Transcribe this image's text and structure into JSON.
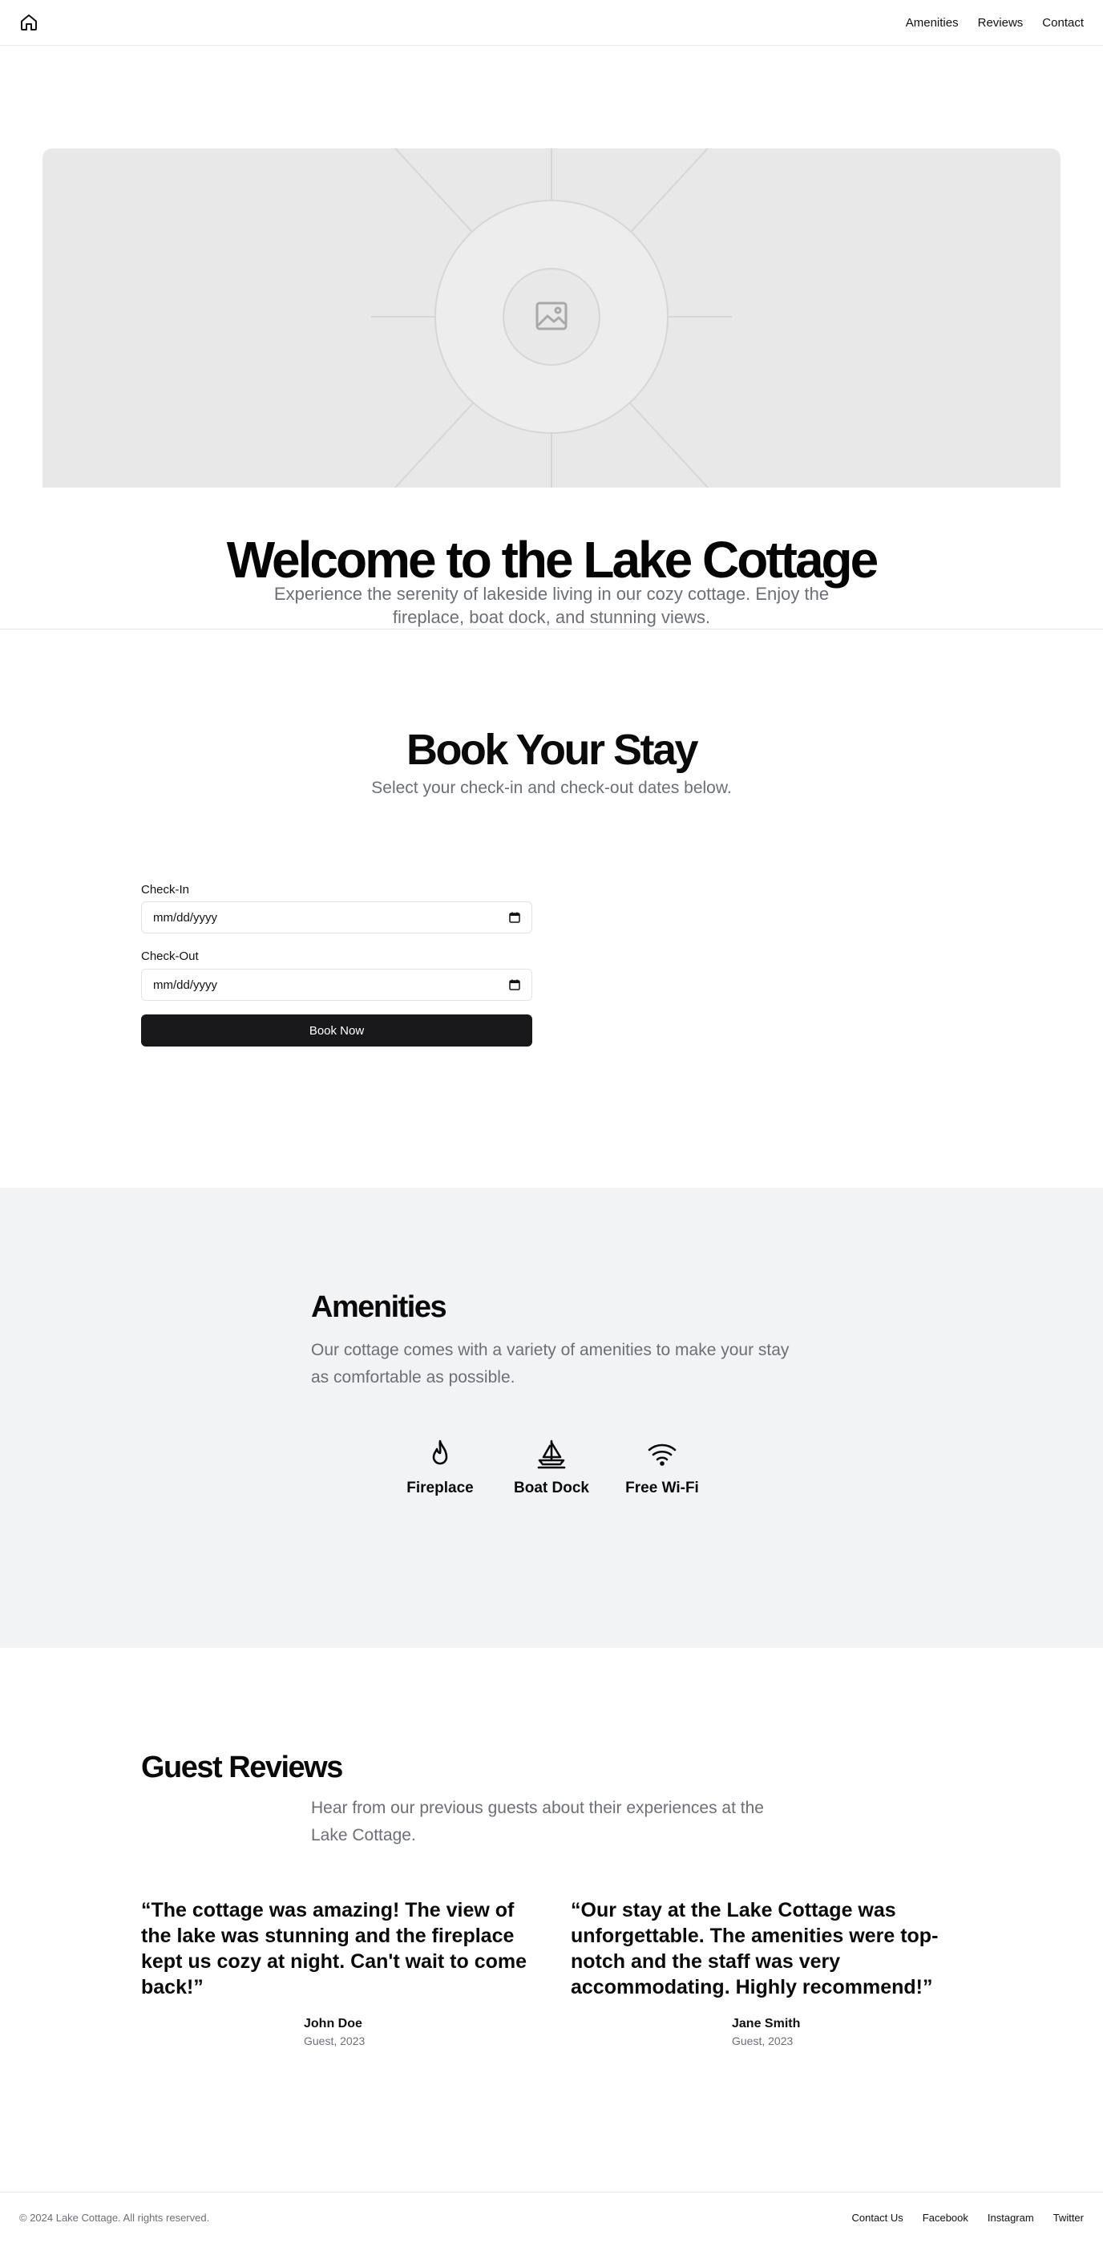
{
  "header": {
    "nav": [
      "Amenities",
      "Reviews",
      "Contact"
    ]
  },
  "hero": {
    "title": "Welcome to the Lake Cottage",
    "subtitle": "Experience the serenity of lakeside living in our cozy cottage. Enjoy the fireplace, boat dock, and stunning views."
  },
  "booking": {
    "title": "Book Your Stay",
    "subtitle": "Select your check-in and check-out dates below.",
    "checkin_label": "Check-In",
    "checkin_value": "mm/dd/yyyy",
    "checkout_label": "Check-Out",
    "checkout_value": "mm/dd/yyyy",
    "button_label": "Book Now"
  },
  "amenities": {
    "title": "Amenities",
    "subtitle": "Our cottage comes with a variety of amenities to make your stay as comfortable as possible.",
    "items": [
      {
        "label": "Fireplace",
        "icon": "flame-icon"
      },
      {
        "label": "Boat Dock",
        "icon": "sailboat-icon"
      },
      {
        "label": "Free Wi-Fi",
        "icon": "wifi-icon"
      }
    ]
  },
  "reviews": {
    "title": "Guest Reviews",
    "subtitle": "Hear from our previous guests about their experiences at the Lake Cottage.",
    "items": [
      {
        "quote": "“The cottage was amazing! The view of the lake was stunning and the fireplace kept us cozy at night. Can't wait to come back!”",
        "name": "John Doe",
        "meta": "Guest, 2023"
      },
      {
        "quote": "“Our stay at the Lake Cottage was unforgettable. The amenities were top-notch and the staff was very accommodating. Highly recommend!”",
        "name": "Jane Smith",
        "meta": "Guest, 2023"
      }
    ]
  },
  "footer": {
    "copyright": "© 2024 Lake Cottage. All rights reserved.",
    "links": [
      "Contact Us",
      "Facebook",
      "Instagram",
      "Twitter"
    ]
  }
}
